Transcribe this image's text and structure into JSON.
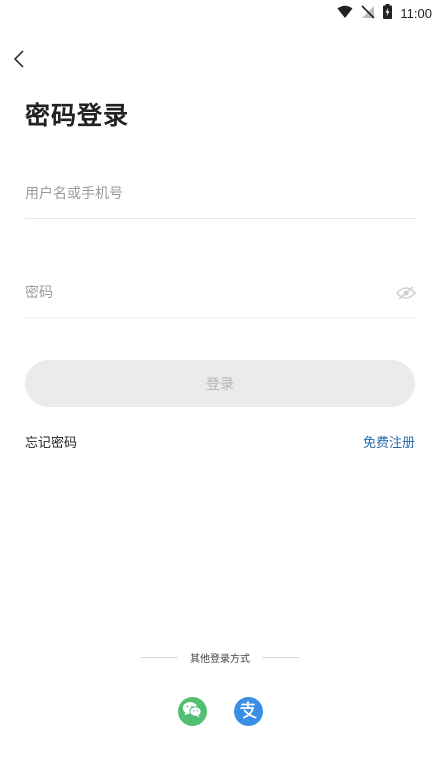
{
  "status_bar": {
    "time": "11:00"
  },
  "login": {
    "title": "密码登录",
    "username_placeholder": "用户名或手机号",
    "password_placeholder": "密码",
    "login_label": "登录",
    "forgot_label": "忘记密码",
    "register_label": "免费注册"
  },
  "other_methods": {
    "label": "其他登录方式",
    "icons": [
      "wechat-icon",
      "alipay-icon"
    ]
  },
  "colors": {
    "accent_link": "#2a6aa8",
    "wechat": "#52bf72",
    "alipay": "#3a8ee6",
    "login_button_bg": "#ebebeb"
  }
}
